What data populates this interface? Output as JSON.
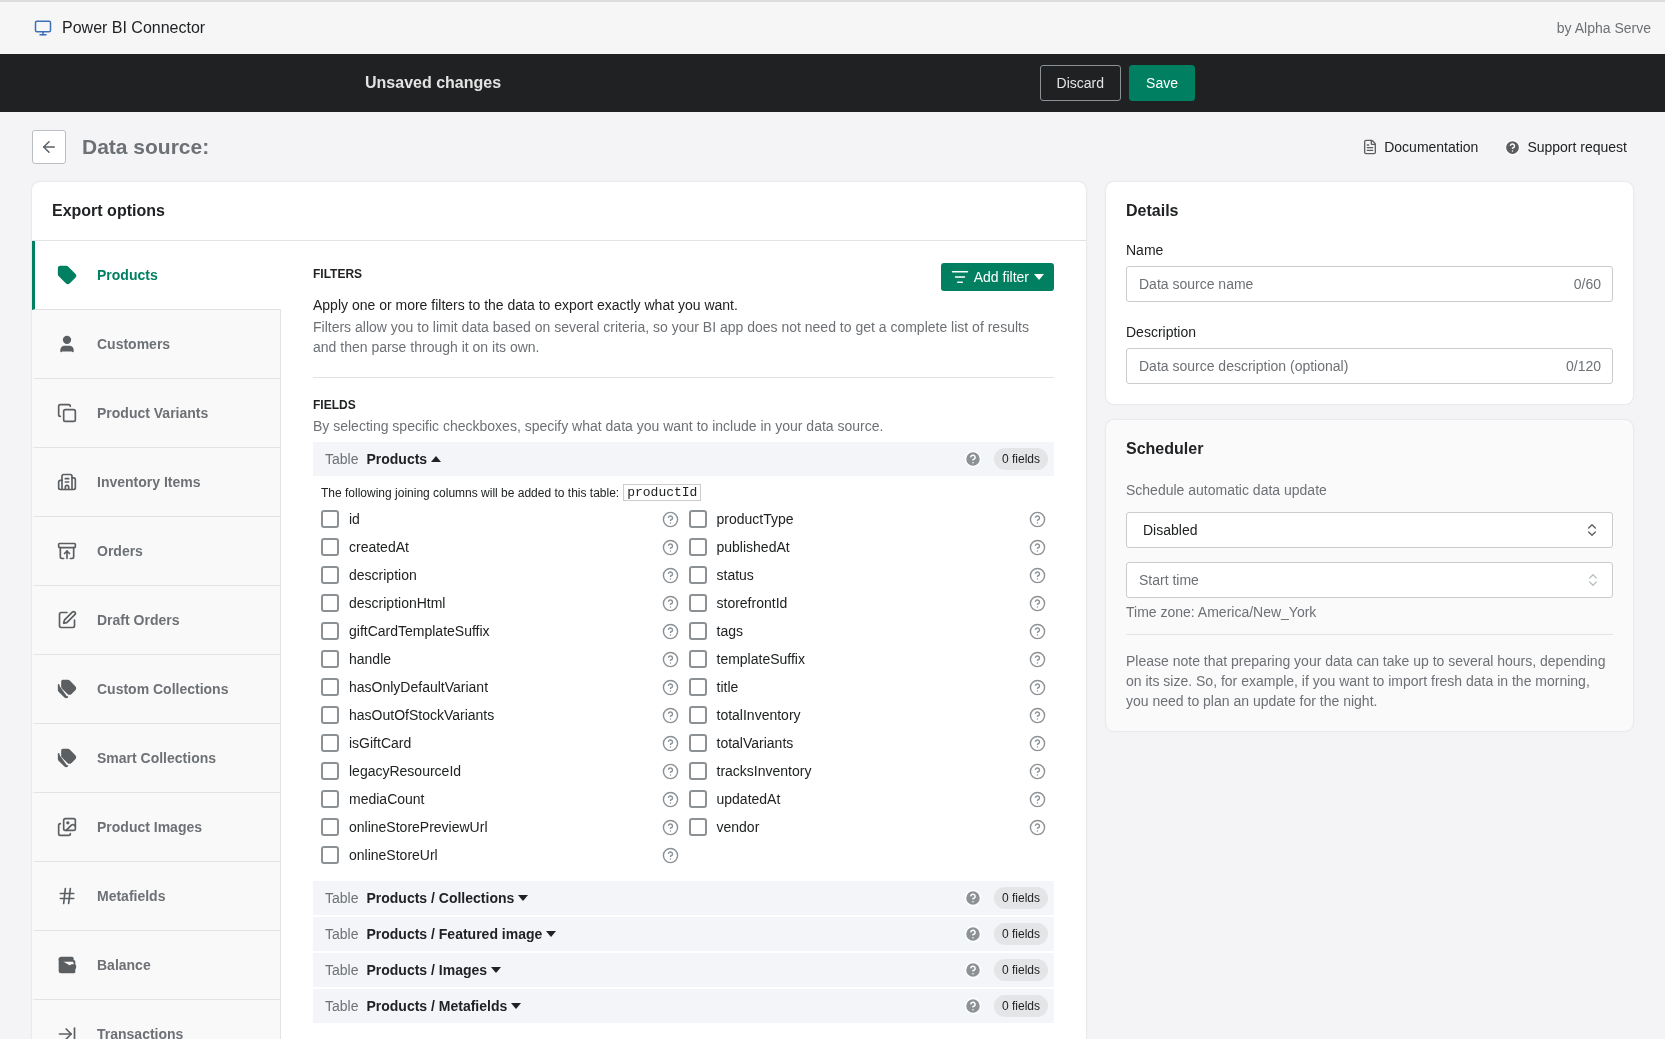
{
  "app_bar": {
    "title": "Power BI Connector",
    "vendor": "by Alpha Serve"
  },
  "save_bar": {
    "message": "Unsaved changes",
    "buttons": [
      {
        "label": "Discard",
        "kind": "secondary"
      },
      {
        "label": "Save",
        "kind": "primary"
      }
    ]
  },
  "page_header": {
    "title": "Data source:",
    "links": [
      "Documentation",
      "Support request"
    ]
  },
  "export_options": {
    "title": "Export options",
    "sidebar": [
      {
        "label": "Products",
        "selected": true
      },
      {
        "label": "Customers",
        "selected": false
      },
      {
        "label": "Product Variants",
        "selected": false
      },
      {
        "label": "Inventory Items",
        "selected": false
      },
      {
        "label": "Orders",
        "selected": false
      },
      {
        "label": "Draft Orders",
        "selected": false
      },
      {
        "label": "Custom Collections",
        "selected": false
      },
      {
        "label": "Smart Collections",
        "selected": false
      },
      {
        "label": "Product Images",
        "selected": false
      },
      {
        "label": "Metafields",
        "selected": false
      },
      {
        "label": "Balance",
        "selected": false
      },
      {
        "label": "Transactions",
        "selected": false
      }
    ],
    "filters": {
      "heading": "FILTERS",
      "button": "Add filter",
      "intro": "Apply one or more filters to the data to export exactly what you want.",
      "hint": "Filters allow you to limit data based on several criteria, so your BI app does not need to get a complete list of results and then parse through it on its own."
    },
    "fields": {
      "heading": "FIELDS",
      "hint": "By selecting specific checkboxes, specify what data you want to include in your data source.",
      "tables": [
        {
          "prefix": "Table",
          "name": "Products",
          "expanded": true,
          "count": "0 fields",
          "joining_note": "The following joining columns will be added to this table:",
          "joining_column": "productId",
          "columns": [
            [
              {
                "label": "id",
                "checked": false
              },
              {
                "label": "createdAt",
                "checked": false
              },
              {
                "label": "description",
                "checked": false
              },
              {
                "label": "descriptionHtml",
                "checked": false
              },
              {
                "label": "giftCardTemplateSuffix",
                "checked": false
              },
              {
                "label": "handle",
                "checked": false
              },
              {
                "label": "hasOnlyDefaultVariant",
                "checked": false
              },
              {
                "label": "hasOutOfStockVariants",
                "checked": false
              },
              {
                "label": "isGiftCard",
                "checked": false
              },
              {
                "label": "legacyResourceId",
                "checked": false
              },
              {
                "label": "mediaCount",
                "checked": false
              },
              {
                "label": "onlineStorePreviewUrl",
                "checked": false
              },
              {
                "label": "onlineStoreUrl",
                "checked": false
              }
            ],
            [
              {
                "label": "productType",
                "checked": false
              },
              {
                "label": "publishedAt",
                "checked": false
              },
              {
                "label": "status",
                "checked": false
              },
              {
                "label": "storefrontId",
                "checked": false
              },
              {
                "label": "tags",
                "checked": false
              },
              {
                "label": "templateSuffix",
                "checked": false
              },
              {
                "label": "title",
                "checked": false
              },
              {
                "label": "totalInventory",
                "checked": false
              },
              {
                "label": "totalVariants",
                "checked": false
              },
              {
                "label": "tracksInventory",
                "checked": false
              },
              {
                "label": "updatedAt",
                "checked": false
              },
              {
                "label": "vendor",
                "checked": false
              }
            ]
          ]
        },
        {
          "prefix": "Table",
          "name": "Products / Collections",
          "expanded": false,
          "count": "0 fields"
        },
        {
          "prefix": "Table",
          "name": "Products / Featured image",
          "expanded": false,
          "count": "0 fields"
        },
        {
          "prefix": "Table",
          "name": "Products / Images",
          "expanded": false,
          "count": "0 fields"
        },
        {
          "prefix": "Table",
          "name": "Products / Metafields",
          "expanded": false,
          "count": "0 fields"
        }
      ]
    }
  },
  "details": {
    "title": "Details",
    "fields": [
      {
        "label": "Name",
        "placeholder": "Data source name",
        "counter": "0/60"
      },
      {
        "label": "Description",
        "placeholder": "Data source description (optional)",
        "counter": "0/120"
      }
    ]
  },
  "scheduler": {
    "title": "Scheduler",
    "subtitle": "Schedule automatic data update",
    "frequency": "Disabled",
    "start_time_placeholder": "Start time",
    "timezone": "Time zone: America/New_York",
    "note": "Please note that preparing your data can take up to several hours, depending on its size. So, for example, if you want to import fresh data in the morning, you need to plan an update for the night."
  }
}
